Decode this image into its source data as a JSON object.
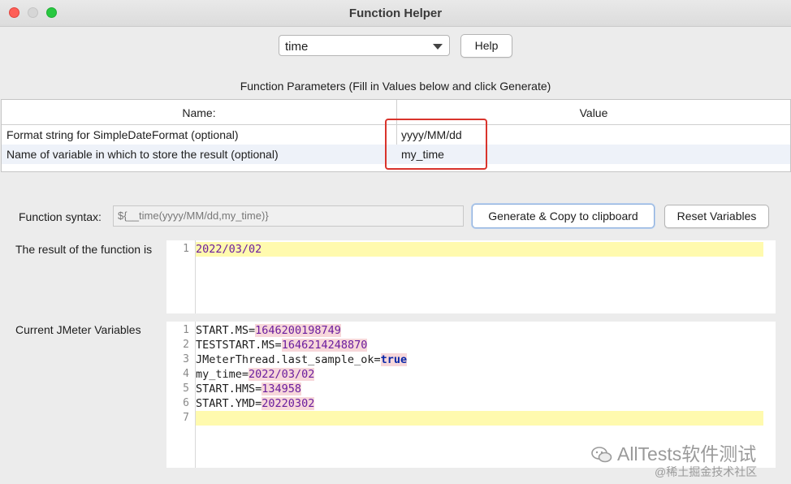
{
  "window": {
    "title": "Function Helper"
  },
  "function_select": {
    "value": "time"
  },
  "help_label": "Help",
  "params": {
    "caption": "Function Parameters (Fill in Values below and click Generate)",
    "header_name": "Name:",
    "header_value": "Value",
    "rows": [
      {
        "name": "Format string for SimpleDateFormat (optional)",
        "value": "yyyy/MM/dd"
      },
      {
        "name": "Name of variable in which to store the result (optional)",
        "value": "my_time"
      }
    ]
  },
  "syntax": {
    "label": "Function syntax:",
    "value": "${__time(yyyy/MM/dd,my_time)}",
    "generate_label": "Generate & Copy to clipboard",
    "reset_label": "Reset Variables"
  },
  "result": {
    "label": "The result of the function is",
    "lines": [
      {
        "n": "1",
        "text": "2022/03/02"
      }
    ]
  },
  "variables": {
    "label": "Current JMeter Variables",
    "lines": [
      {
        "n": "1",
        "key": "START.MS",
        "value": "1646200198749"
      },
      {
        "n": "2",
        "key": "TESTSTART.MS",
        "value": "1646214248870"
      },
      {
        "n": "3",
        "key": "JMeterThread.last_sample_ok",
        "value": "true"
      },
      {
        "n": "4",
        "key": "my_time",
        "value": "2022/03/02"
      },
      {
        "n": "5",
        "key": "START.HMS",
        "value": "134958"
      },
      {
        "n": "6",
        "key": "START.YMD",
        "value": "20220302"
      },
      {
        "n": "7",
        "key": "",
        "value": ""
      }
    ]
  },
  "watermark": {
    "main": "AllTests软件测试",
    "sub": "@稀土掘金技术社区"
  },
  "colors": {
    "highlight_box": "#d9342c",
    "number": "#6b1d9e",
    "keyword": "#0b28a8",
    "current_line": "#fffaae"
  }
}
